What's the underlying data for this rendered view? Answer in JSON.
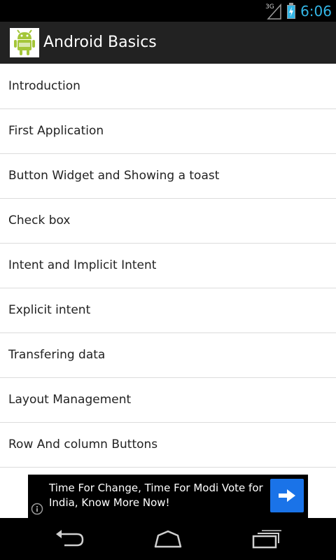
{
  "status_bar": {
    "network": "3G",
    "time": "6:06",
    "icons": [
      "signal-icon",
      "battery-charging-icon"
    ]
  },
  "action_bar": {
    "title": "Android Basics",
    "icon": "android-app-icon"
  },
  "topics": [
    "Introduction",
    "First Application",
    "Button Widget and Showing a toast",
    "Check box",
    "Intent and Implicit Intent",
    "Explicit intent",
    "Transfering data",
    "Layout Management",
    "Row And column Buttons"
  ],
  "ad": {
    "text": "Time For Change, Time For Modi Vote for India, Know More Now!",
    "icons": [
      "info-icon",
      "arrow-right-icon"
    ],
    "button_color": "#1a73e8"
  },
  "navigation": {
    "icons": [
      "back-icon",
      "home-icon",
      "recent-apps-icon"
    ]
  },
  "colors": {
    "clock": "#33b5e5",
    "action_bar": "#222222",
    "android_green": "#a4c639"
  }
}
